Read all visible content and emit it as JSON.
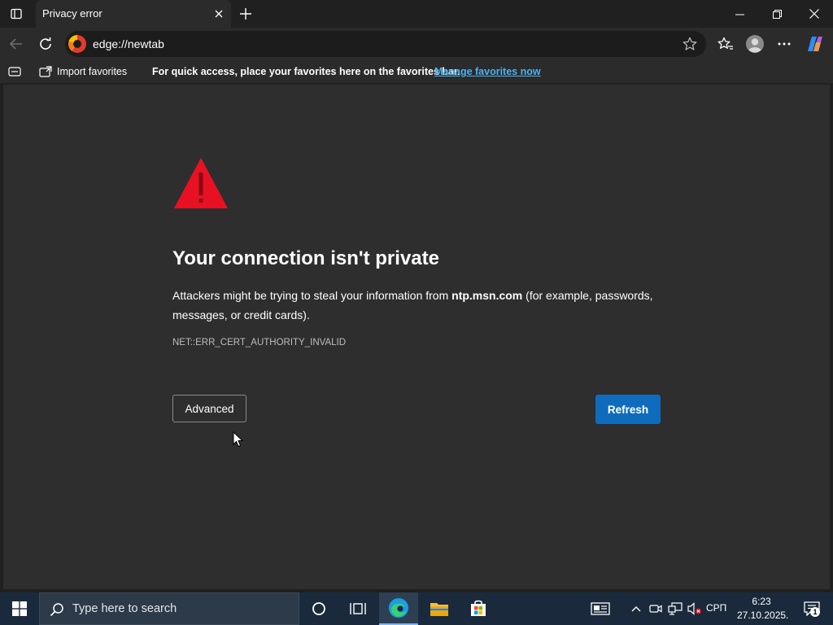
{
  "tab": {
    "title": "Privacy error"
  },
  "address_bar": {
    "url": "edge://newtab"
  },
  "favorites_bar": {
    "import_label": "Import favorites",
    "message": "For quick access, place your favorites here on the favorites bar.",
    "manage_link": "Manage favorites now"
  },
  "error_page": {
    "heading": "Your connection isn't private",
    "desc_prefix": "Attackers might be trying to steal your information from ",
    "desc_domain": "ntp.msn.com",
    "desc_suffix": " (for example, passwords, messages, or credit cards).",
    "error_code": "NET::ERR_CERT_AUTHORITY_INVALID",
    "advanced_label": "Advanced",
    "refresh_label": "Refresh",
    "warning_color": "#e81123"
  },
  "taskbar": {
    "search_placeholder": "Type here to search",
    "language": "СРП",
    "time": "6:23",
    "date": "27.10.2025.",
    "notification_count": "1"
  }
}
